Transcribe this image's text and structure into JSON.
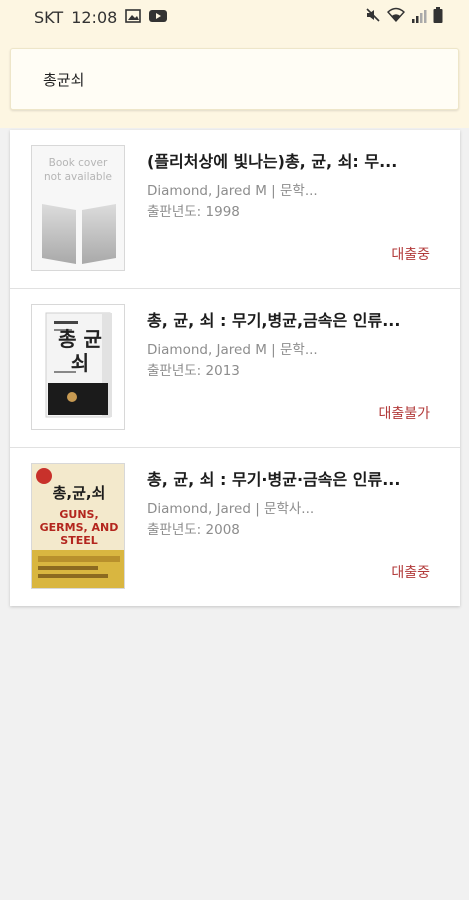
{
  "status_bar": {
    "carrier": "SKT",
    "time": "12:08",
    "icons": [
      "image-icon",
      "youtube-icon",
      "mute-icon",
      "wifi-icon",
      "signal-icon",
      "battery-icon"
    ]
  },
  "search": {
    "value": "총균쇠"
  },
  "results": [
    {
      "title": "(플리처상에 빛나는)총, 균, 쇠: 무...",
      "author": "Diamond, Jared M | 문학...",
      "year": "출판년도: 1998",
      "status": "대출중",
      "cover": {
        "type": "placeholder",
        "text_line1": "Book cover",
        "text_line2": "not available"
      }
    },
    {
      "title": "총, 균, 쇠 : 무기,병균,금속은 인류...",
      "author": "Diamond, Jared M | 문학...",
      "year": "출판년도: 2013",
      "status": "대출불가",
      "cover": {
        "type": "image",
        "title_text": "총 균 쇠"
      }
    },
    {
      "title": "총, 균, 쇠 : 무기·병균·금속은 인류...",
      "author": "Diamond, Jared | 문학사...",
      "year": "출판년도: 2008",
      "status": "대출중",
      "cover": {
        "type": "image",
        "title_text": "총,균,쇠",
        "subtitle_text": "GUNS, GERMS, AND STEEL"
      }
    }
  ],
  "colors": {
    "header_bg": "#fdf6e2",
    "status_red": "#b23a3a",
    "meta_gray": "#8d8d8d"
  }
}
